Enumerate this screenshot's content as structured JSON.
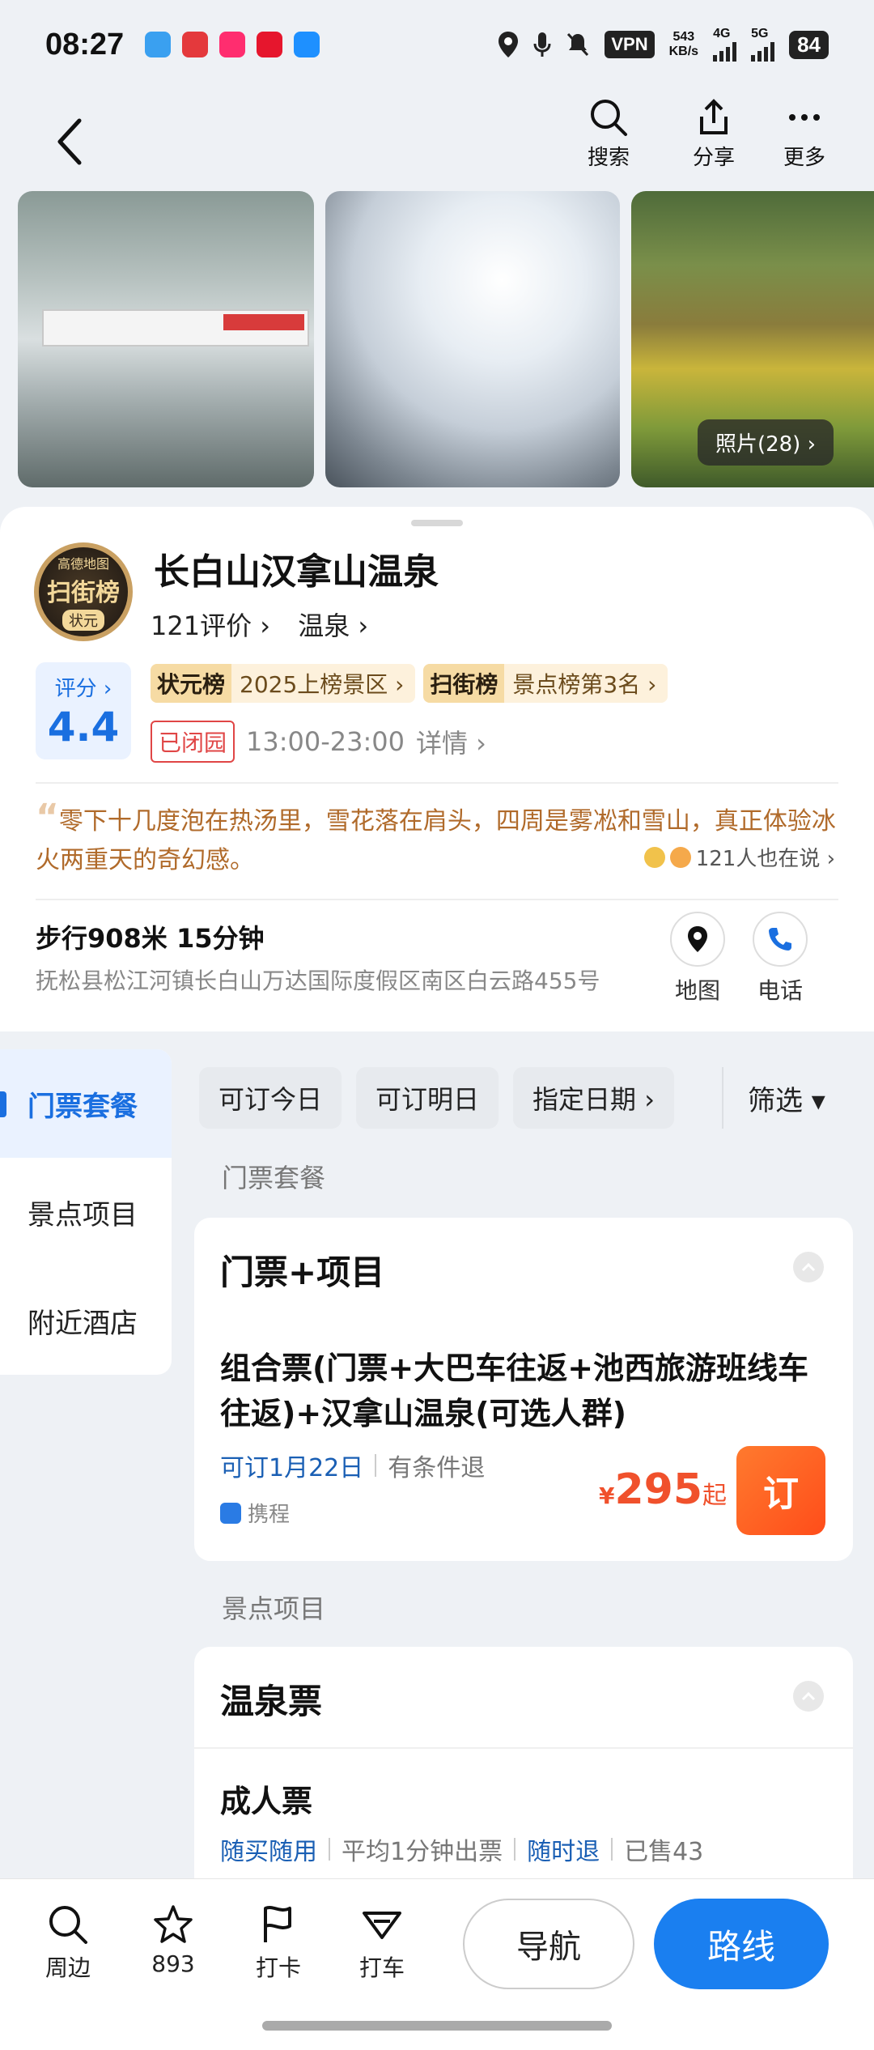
{
  "status_bar": {
    "time": "08:27",
    "vpn": "VPN",
    "speed_value": "543",
    "speed_unit": "KB/s",
    "network_4g": "4G",
    "network_5g": "5G",
    "battery": "84"
  },
  "top_nav": {
    "search_label": "搜索",
    "share_label": "分享",
    "more_label": "更多"
  },
  "photos": {
    "count_label": "照片(28) ›"
  },
  "poi": {
    "badge_brand": "高德地图",
    "badge_title": "扫街榜",
    "badge_sub": "状元",
    "name": "长白山汉拿山温泉",
    "reviews_link": "121评价 ›",
    "category_link": "温泉 ›",
    "score_label": "评分 ›",
    "score_value": "4.4",
    "rank1_badge": "状元榜",
    "rank1_text": "2025上榜景区 ›",
    "rank2_badge": "扫街榜",
    "rank2_text": "景点榜第3名 ›",
    "status_closed": "已闭园",
    "hours": "13:00-23:00",
    "details_link": "详情 ›",
    "quote": "零下十几度泡在热汤里，雪花落在肩头，四周是雾凇和雪山，真正体验冰火两重天的奇幻感。",
    "quote_meta": "121人也在说 ›",
    "walk_info": "步行908米 15分钟",
    "address": "抚松县松江河镇长白山万达国际度假区南区白云路455号",
    "map_label": "地图",
    "phone_label": "电话"
  },
  "left_nav": {
    "items": [
      "门票套餐",
      "景点项目",
      "附近酒店"
    ]
  },
  "filters": {
    "chips": [
      "可订今日",
      "可订明日",
      "指定日期 ›"
    ],
    "filter_label": "筛选 ▾"
  },
  "section_tickets": {
    "label": "门票套餐",
    "card_title": "门票+项目",
    "package_name": "组合票(门票+大巴车往返+池西旅游班线车往返)+汉拿山温泉(可选人群)",
    "bookable_date": "可订1月22日",
    "refund_policy": "有条件退",
    "provider": "携程",
    "price_symbol": "¥",
    "price": "295",
    "price_suffix": "起",
    "book_label": "订"
  },
  "section_attractions": {
    "label": "景点项目",
    "card_title": "温泉票",
    "ticket_name": "成人票",
    "tag1": "随买随用",
    "tag2": "平均1分钟出票",
    "tag3": "随时退",
    "tag4": "已售43"
  },
  "bottom_bar": {
    "nearby_label": "周边",
    "favorites_count": "893",
    "checkin_label": "打卡",
    "taxi_label": "打车",
    "navigate_label": "导航",
    "route_label": "路线"
  },
  "colors": {
    "accent_blue": "#1a7ff0",
    "price_orange": "#f0512c",
    "closed_red": "#e04646",
    "quote_brown": "#b06a2a"
  }
}
